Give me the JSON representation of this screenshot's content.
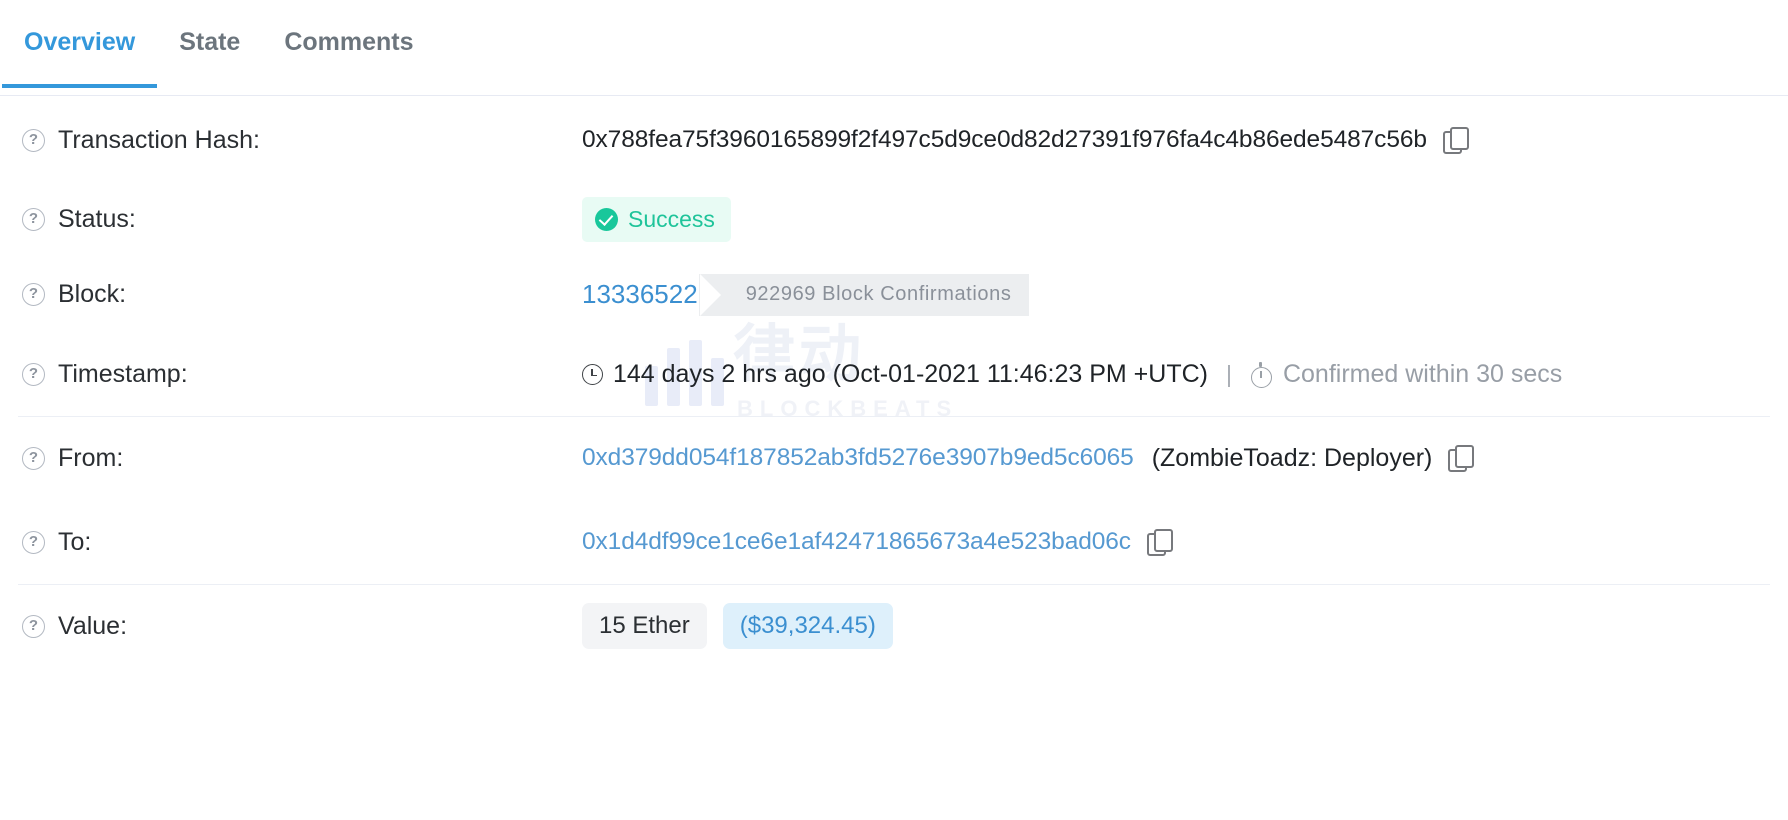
{
  "tabs": [
    {
      "label": "Overview",
      "active": true
    },
    {
      "label": "State",
      "active": false
    },
    {
      "label": "Comments",
      "active": false
    }
  ],
  "watermark": {
    "cn": "律动",
    "en": "BLOCKBEATS"
  },
  "rows": {
    "transaction_hash": {
      "label": "Transaction Hash:",
      "value": "0x788fea75f3960165899f2f497c5d9ce0d82d27391f976fa4c4b86ede5487c56b",
      "copy_icon": "copy-icon",
      "help_icon": "question-mark-icon"
    },
    "status": {
      "label": "Status:",
      "badge": "Success",
      "badge_icon": "check-circle-icon",
      "badge_bg": "#e8fbf4",
      "badge_color": "#1fc49a"
    },
    "block": {
      "label": "Block:",
      "number": "13336522",
      "confirmations": "922969 Block Confirmations",
      "link_color": "#3b8fd0"
    },
    "timestamp": {
      "label": "Timestamp:",
      "clock_icon": "clock-icon",
      "age": "144 days 2 hrs ago (Oct-01-2021 11:46:23 PM +UTC)",
      "divider": "|",
      "confirm_icon": "stopwatch-icon",
      "confirm_text": "Confirmed within 30 secs"
    },
    "from": {
      "label": "From:",
      "address": "0xd379dd054f187852ab3fd5276e3907b9ed5c6065",
      "tag": "(ZombieToadz: Deployer)",
      "copy_icon": "copy-icon"
    },
    "to": {
      "label": "To:",
      "address": "0x1d4df99ce1ce6e1af42471865673a4e523bad06c",
      "copy_icon": "copy-icon"
    },
    "value": {
      "label": "Value:",
      "ether": "15 Ether",
      "usd": "($39,324.45)",
      "usd_color": "#3b8fd0"
    }
  }
}
